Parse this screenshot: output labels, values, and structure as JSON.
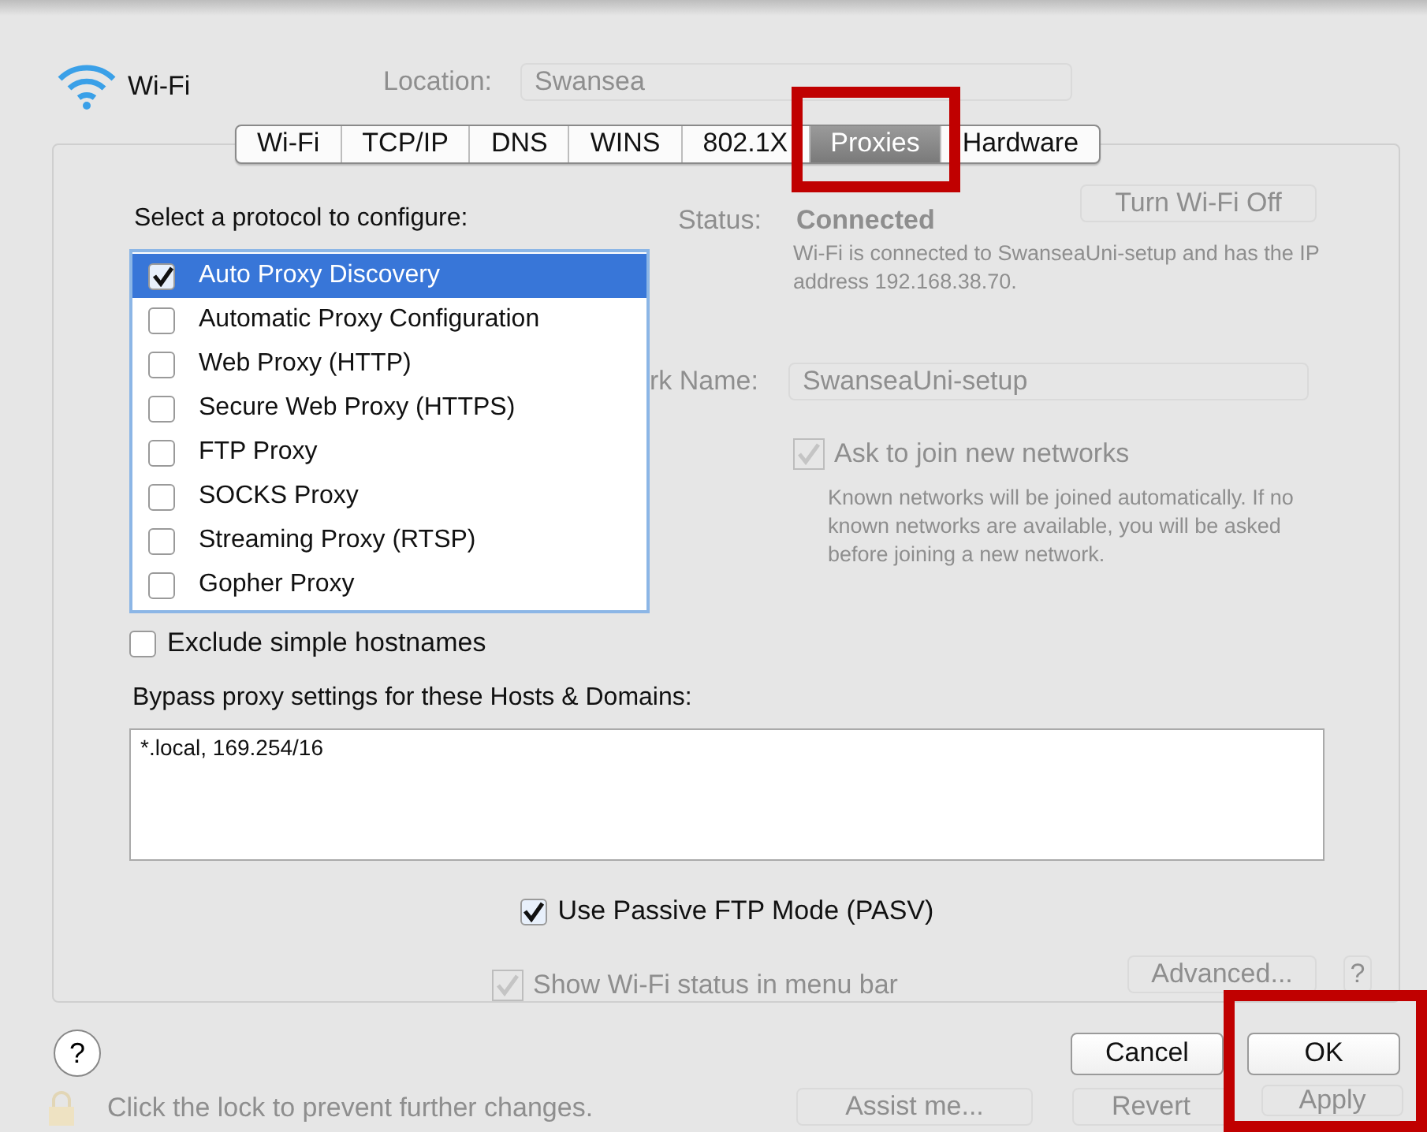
{
  "window": {
    "title": "Wi-Fi"
  },
  "background": {
    "location_label": "Location:",
    "location_value": "Swansea",
    "status_label": "Status:",
    "status_value": "Connected",
    "turn_off_button": "Turn Wi-Fi Off",
    "status_description": "Wi-Fi is connected to SwanseaUni-setup and has the IP address 192.168.38.70.",
    "network_name_label": "rk Name:",
    "network_name_value": "SwanseaUni-setup",
    "ask_to_join": {
      "label": "Ask to join new networks",
      "checked": true
    },
    "ask_to_join_note": "Known networks will be joined automatically. If no known networks are available, you will be asked before joining a new network.",
    "show_status": {
      "label": "Show Wi-Fi status in menu bar",
      "checked": true
    },
    "advanced_button": "Advanced...",
    "help_button": "?",
    "lock_text": "Click the lock to prevent further changes.",
    "assist_button": "Assist me...",
    "revert_button": "Revert",
    "apply_button": "Apply"
  },
  "tabs": [
    {
      "label": "Wi-Fi",
      "selected": false,
      "highlighted": false
    },
    {
      "label": "TCP/IP",
      "selected": false,
      "highlighted": false
    },
    {
      "label": "DNS",
      "selected": false,
      "highlighted": false
    },
    {
      "label": "WINS",
      "selected": false,
      "highlighted": false
    },
    {
      "label": "802.1X",
      "selected": false,
      "highlighted": false
    },
    {
      "label": "Proxies",
      "selected": true,
      "highlighted": true
    },
    {
      "label": "Hardware",
      "selected": false,
      "highlighted": false
    }
  ],
  "protocol_label": "Select a protocol to configure:",
  "protocols": [
    {
      "label": "Auto Proxy Discovery",
      "checked": true,
      "selected": true
    },
    {
      "label": "Automatic Proxy Configuration",
      "checked": false,
      "selected": false
    },
    {
      "label": "Web Proxy (HTTP)",
      "checked": false,
      "selected": false
    },
    {
      "label": "Secure Web Proxy (HTTPS)",
      "checked": false,
      "selected": false
    },
    {
      "label": "FTP Proxy",
      "checked": false,
      "selected": false
    },
    {
      "label": "SOCKS Proxy",
      "checked": false,
      "selected": false
    },
    {
      "label": "Streaming Proxy (RTSP)",
      "checked": false,
      "selected": false
    },
    {
      "label": "Gopher Proxy",
      "checked": false,
      "selected": false
    }
  ],
  "exclude_simple_hostnames": {
    "label": "Exclude simple hostnames",
    "checked": false
  },
  "bypass_label": "Bypass proxy settings for these Hosts & Domains:",
  "bypass_value": "*.local, 169.254/16",
  "passive_ftp": {
    "label": "Use Passive FTP Mode (PASV)",
    "checked": true
  },
  "help_button": "?",
  "buttons": [
    {
      "label": "Cancel",
      "highlighted": false
    },
    {
      "label": "OK",
      "highlighted": true
    }
  ]
}
